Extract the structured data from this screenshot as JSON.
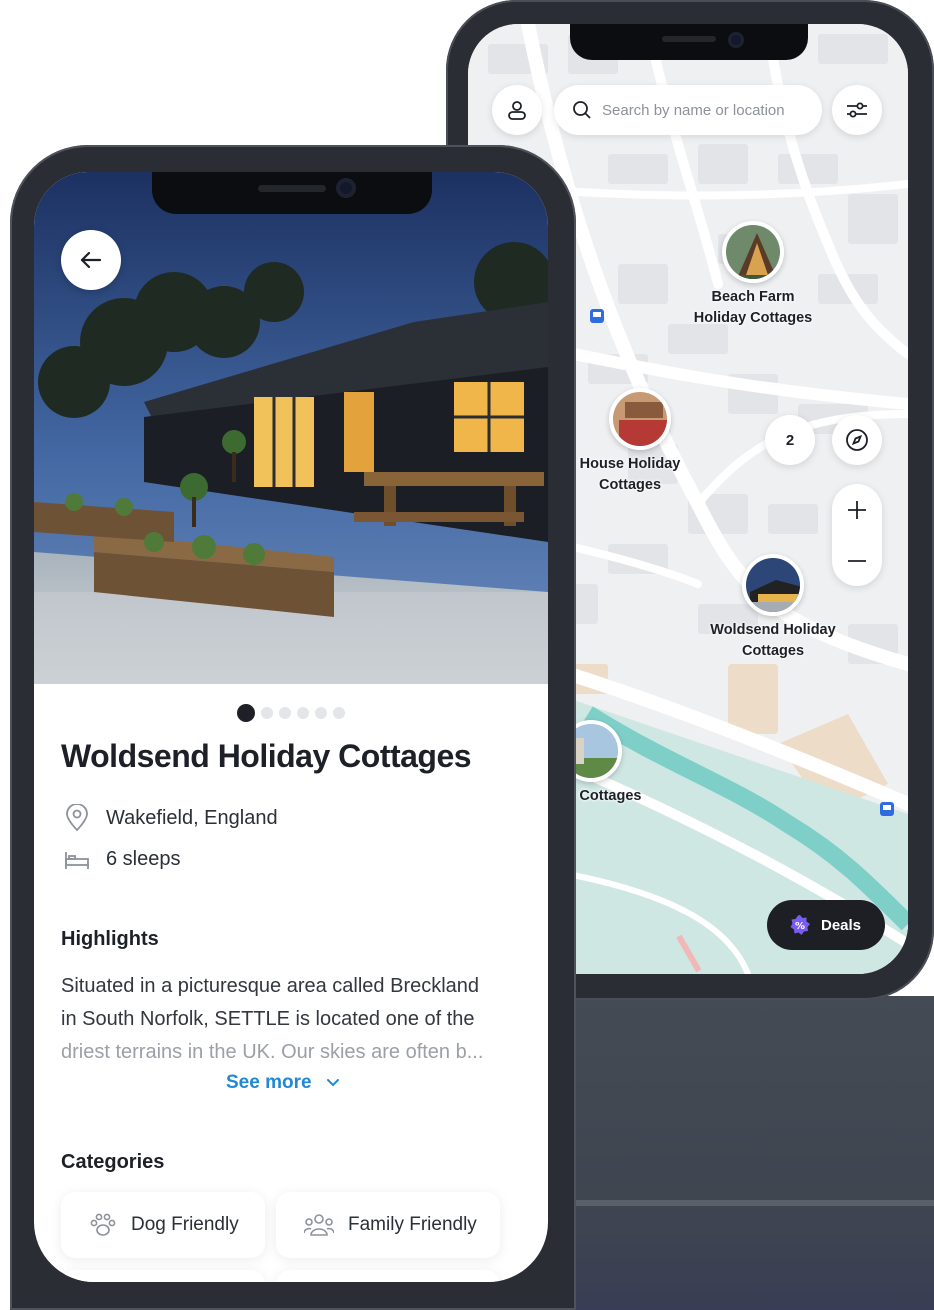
{
  "map_screen": {
    "search": {
      "placeholder": "Search by name or location"
    },
    "icons": {
      "profile": "user-icon",
      "search": "search-icon",
      "filter": "sliders-icon",
      "compass": "compass-icon",
      "zoom_in": "plus-icon",
      "zoom_out": "minus-icon",
      "deals": "discount-badge-icon"
    },
    "pins": [
      {
        "line1": "Beach Farm",
        "line2": "Holiday Cottages"
      },
      {
        "line1": "House Holiday",
        "line2": "Cottages"
      },
      {
        "line1": "Woldsend Holiday",
        "line2": "Cottages"
      },
      {
        "line1": "te Cottages",
        "line2": ""
      }
    ],
    "cluster_count": "2",
    "deals_label": "Deals"
  },
  "detail_screen": {
    "title": "Woldsend Holiday Cottages",
    "location": "Wakefield, England",
    "sleeps": "6 sleeps",
    "carousel": {
      "total": 6,
      "active": 1
    },
    "highlights_heading": "Highlights",
    "highlights_line1": "Situated in a picturesque area called Breckland",
    "highlights_line2": "in South Norfolk, SETTLE is located one of the",
    "highlights_line3": "driest terrains in the UK. Our skies are often b...",
    "see_more_label": "See more",
    "categories_heading": "Categories",
    "categories": [
      {
        "label": "Dog Friendly",
        "icon": "paw-icon"
      },
      {
        "label": "Family Friendly",
        "icon": "family-icon"
      }
    ]
  },
  "colors": {
    "link": "#2388d4",
    "dark": "#1d2127",
    "deals_bg": "#1d1f24",
    "river": "#7fcfc9",
    "deals_badge": "#7b5cf0"
  }
}
